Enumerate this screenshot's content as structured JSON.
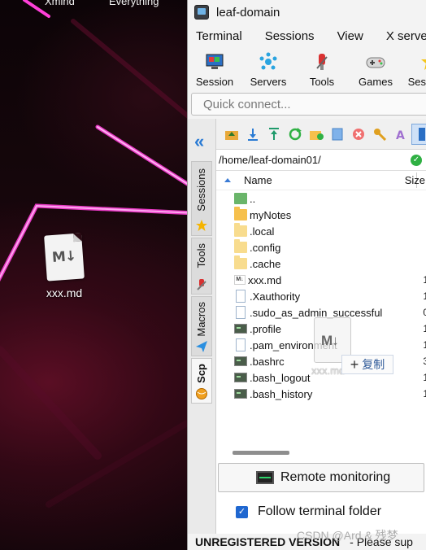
{
  "desktop": {
    "top_labels": [
      "Xmind",
      "Everything"
    ],
    "file_icon": {
      "name": "xxx.md",
      "icon": "markdown-file-icon"
    }
  },
  "window": {
    "title": "leaf-domain",
    "menu": [
      "Terminal",
      "Sessions",
      "View",
      "X server"
    ],
    "ribbon": [
      {
        "label": "Session",
        "icon": "session-icon"
      },
      {
        "label": "Servers",
        "icon": "servers-icon"
      },
      {
        "label": "Tools",
        "icon": "tools-icon"
      },
      {
        "label": "Games",
        "icon": "games-icon"
      },
      {
        "label": "Sessions",
        "icon": "star-icon"
      }
    ],
    "quick_connect_placeholder": "Quick connect...",
    "side_tabs": [
      "Sessions",
      "Tools",
      "Macros",
      "Scp"
    ],
    "path": "/home/leaf-domain01/",
    "columns": {
      "name": "Name",
      "size": "Size"
    },
    "files": [
      {
        "name": "..",
        "type": "up",
        "size": ""
      },
      {
        "name": "myNotes",
        "type": "folder",
        "size": ""
      },
      {
        "name": ".local",
        "type": "folder-light",
        "size": ""
      },
      {
        "name": ".config",
        "type": "folder-light",
        "size": ""
      },
      {
        "name": ".cache",
        "type": "folder-light",
        "size": ""
      },
      {
        "name": "xxx.md",
        "type": "md",
        "size": "1"
      },
      {
        "name": ".Xauthority",
        "type": "doc",
        "size": "1"
      },
      {
        "name": ".sudo_as_admin_successful",
        "type": "doc",
        "size": "0"
      },
      {
        "name": ".profile",
        "type": "term",
        "size": "1"
      },
      {
        "name": ".pam_environment",
        "type": "doc",
        "size": "1"
      },
      {
        "name": ".bashrc",
        "type": "term",
        "size": "3"
      },
      {
        "name": ".bash_logout",
        "type": "term",
        "size": "1"
      },
      {
        "name": ".bash_history",
        "type": "term",
        "size": "1"
      }
    ],
    "drag": {
      "ghost_label": "xxx.md",
      "tooltip": "复制"
    },
    "remote_monitoring": "Remote monitoring",
    "follow_terminal": "Follow terminal folder",
    "status": {
      "unregistered": "UNREGISTERED VERSION",
      "message": "-  Please sup"
    }
  },
  "watermark": "CSDN @Ard & 残梦"
}
